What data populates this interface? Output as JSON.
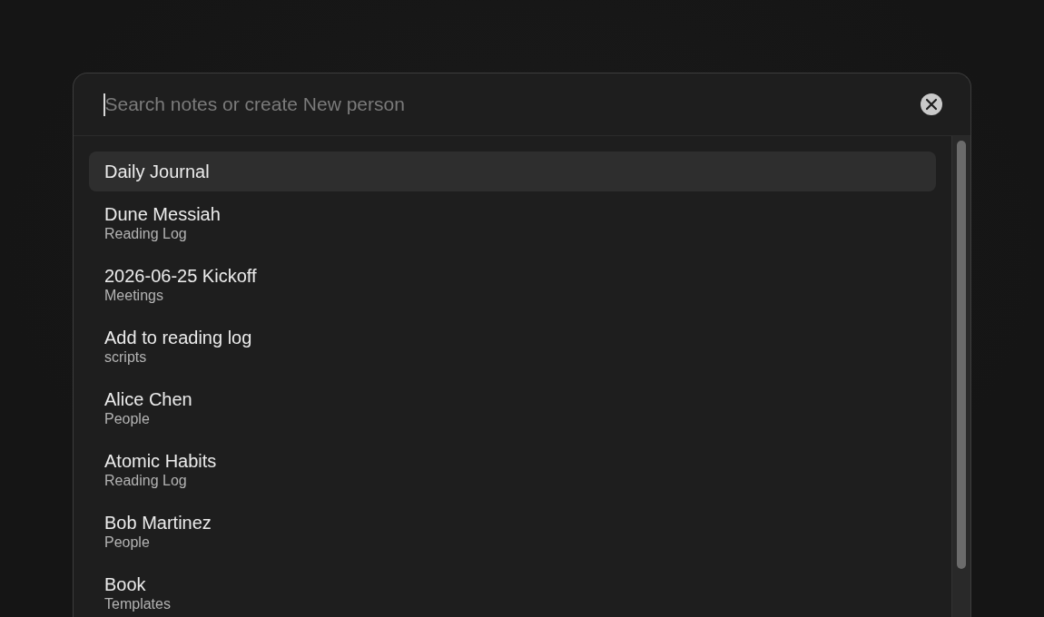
{
  "search": {
    "placeholder": "Search notes or create New person",
    "focused": true
  },
  "results": [
    {
      "title": "Daily Journal",
      "selected": true
    },
    {
      "title": "Dune Messiah",
      "folder": "Reading Log",
      "selected": false
    },
    {
      "title": "2026-06-25 Kickoff",
      "folder": "Meetings",
      "selected": false
    },
    {
      "title": "Add to reading log",
      "folder": "scripts",
      "selected": false
    },
    {
      "title": "Alice Chen",
      "folder": "People",
      "selected": false
    },
    {
      "title": "Atomic Habits",
      "folder": "Reading Log",
      "selected": false
    },
    {
      "title": "Bob Martinez",
      "folder": "People",
      "selected": false
    },
    {
      "title": "Book",
      "folder": "Templates",
      "selected": false
    }
  ]
}
